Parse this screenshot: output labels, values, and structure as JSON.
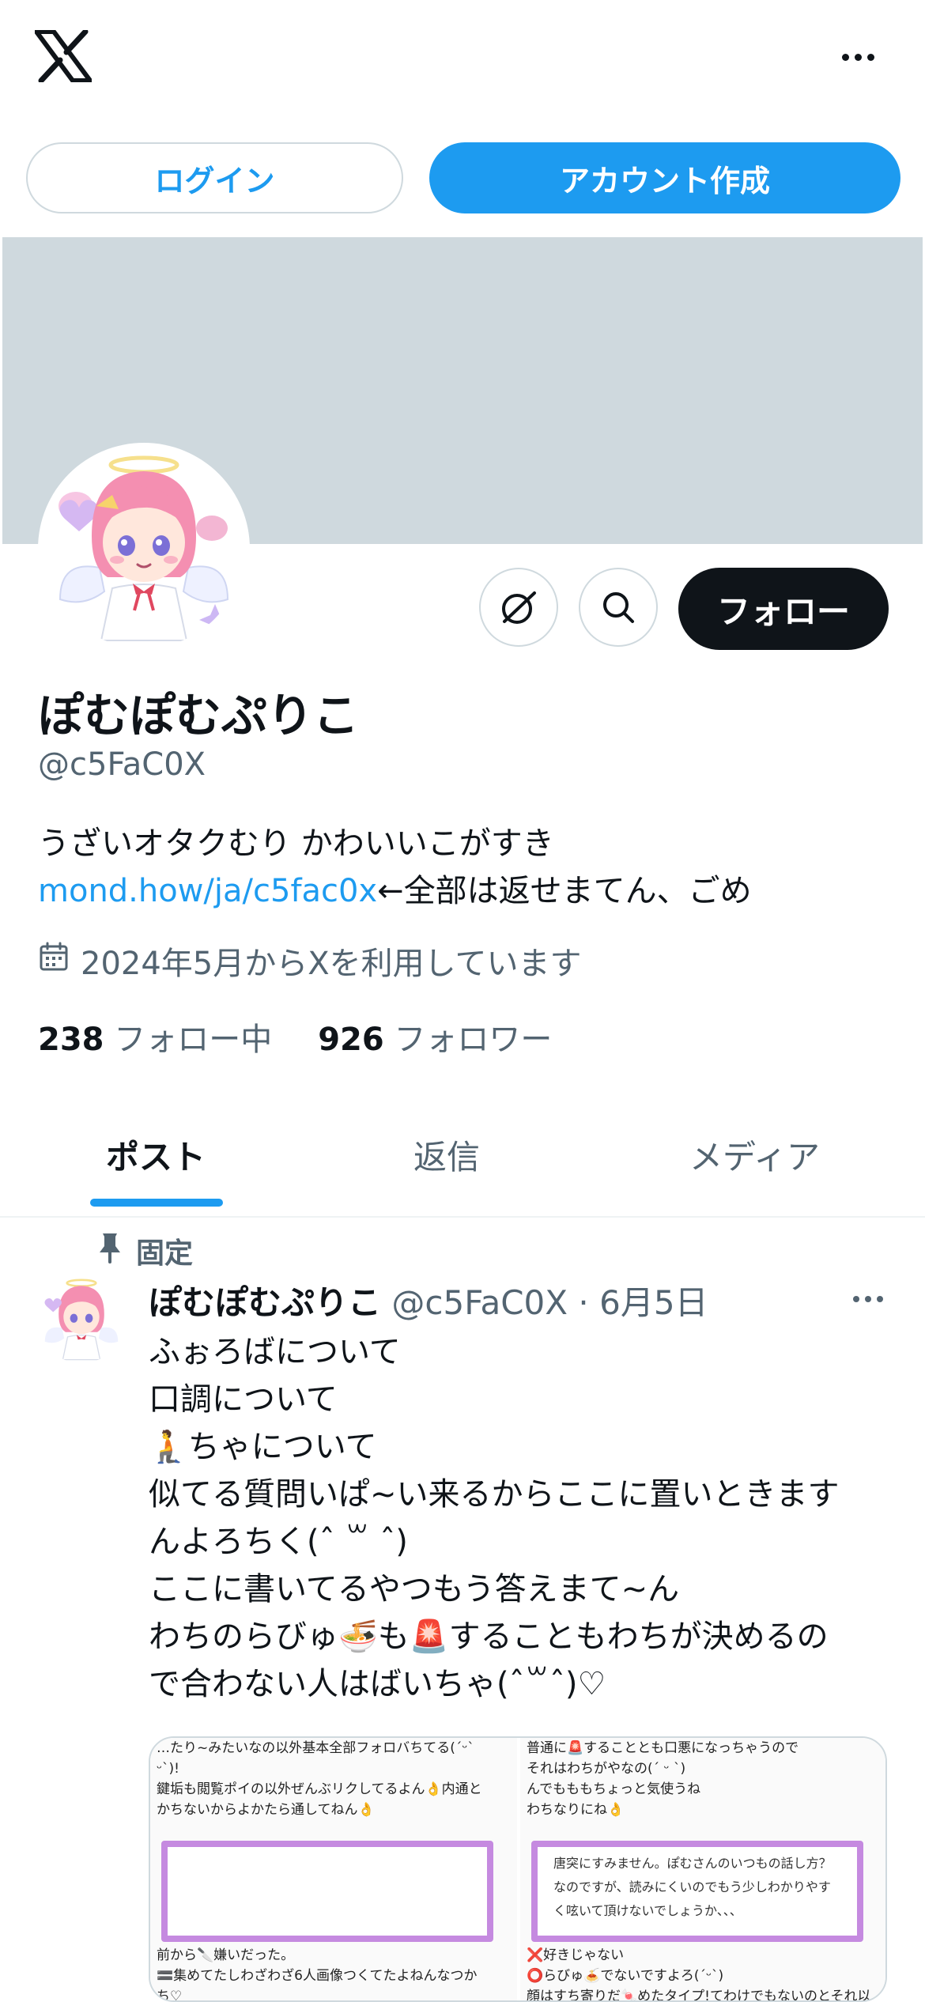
{
  "header": {
    "logo": "X",
    "more_icon": "more-horizontal-icon"
  },
  "auth": {
    "login_label": "ログイン",
    "signup_label": "アカウント作成"
  },
  "colors": {
    "accent": "#1d9bf0",
    "banner": "#cfd9de",
    "text": "#0f1419",
    "muted": "#536471",
    "image_frame": "#c58ae0"
  },
  "profile": {
    "follow_label": "フォロー",
    "display_name": "ぽむぽむぷりこ",
    "handle": "@c5FaC0X",
    "bio_line1": "うざいオタクむり かわいいこがすき",
    "bio_link": "mond.how/ja/c5fac0x",
    "bio_after_link": "←全部は返せまてん、ごめ",
    "joined": "2024年5月からXを利用しています",
    "following_count": "238",
    "following_label": "フォロー中",
    "followers_count": "926",
    "followers_label": "フォロワー"
  },
  "tabs": [
    {
      "label": "ポスト"
    },
    {
      "label": "返信"
    },
    {
      "label": "メディア"
    }
  ],
  "post": {
    "pinned_label": "固定",
    "author_name": "ぽむぽむぷりこ",
    "author_handle": "@c5FaC0X",
    "separator": "·",
    "date": "6月5日",
    "lines": [
      "ふぉろばについて",
      "口調について",
      "🧎ちゃについて",
      "似てる質問いぱ~い来るからここに置いときます",
      "んよろちく(ˆ ꒳ ˆ)",
      "ここに書いてるやつもう答えまて~ん",
      "わちのらびゅ🍜も🚨することもわちが決めるの",
      "で合わない人はばいちゃ(ˆ꒳ˆ)♡"
    ],
    "media": {
      "left_top": [
        "…たり~みたいなの以外基本全部フォロバちてる(ˊᵕˋ",
        "ᵕˋ)!",
        "鍵垢も閲覧ポイの以外ぜんぶリクしてるよん👌内通と",
        "かちないからよかたら通してねん👌"
      ],
      "left_bottom": [
        "前から🔪嫌いだった。",
        "🟰集めてたしわざわざ6人画像つくてたよねんなつか",
        "ち♡"
      ],
      "right_top": [
        "普通に🚨することとも口悪になっちゃうので",
        "それはわちがやなの(ˊ ᵕ ˋ)",
        "んでもももちょっと気使うね",
        "わちなりにね👌"
      ],
      "right_inner": [
        "唐突にすみません。ぽむさんのいつもの話し方？",
        "なのですが、読みにくいのでもう少しわかりやす",
        "く呟いて頂けないでしょうか、、、"
      ],
      "right_bottom": [
        "❌好きじゃない",
        "⭕らびゅ🍝でないですよろ(ˊᵕˋ)",
        "顔はすち寄りだ🍬めたタイプ!てわけでもないのとそれ以"
      ]
    }
  }
}
